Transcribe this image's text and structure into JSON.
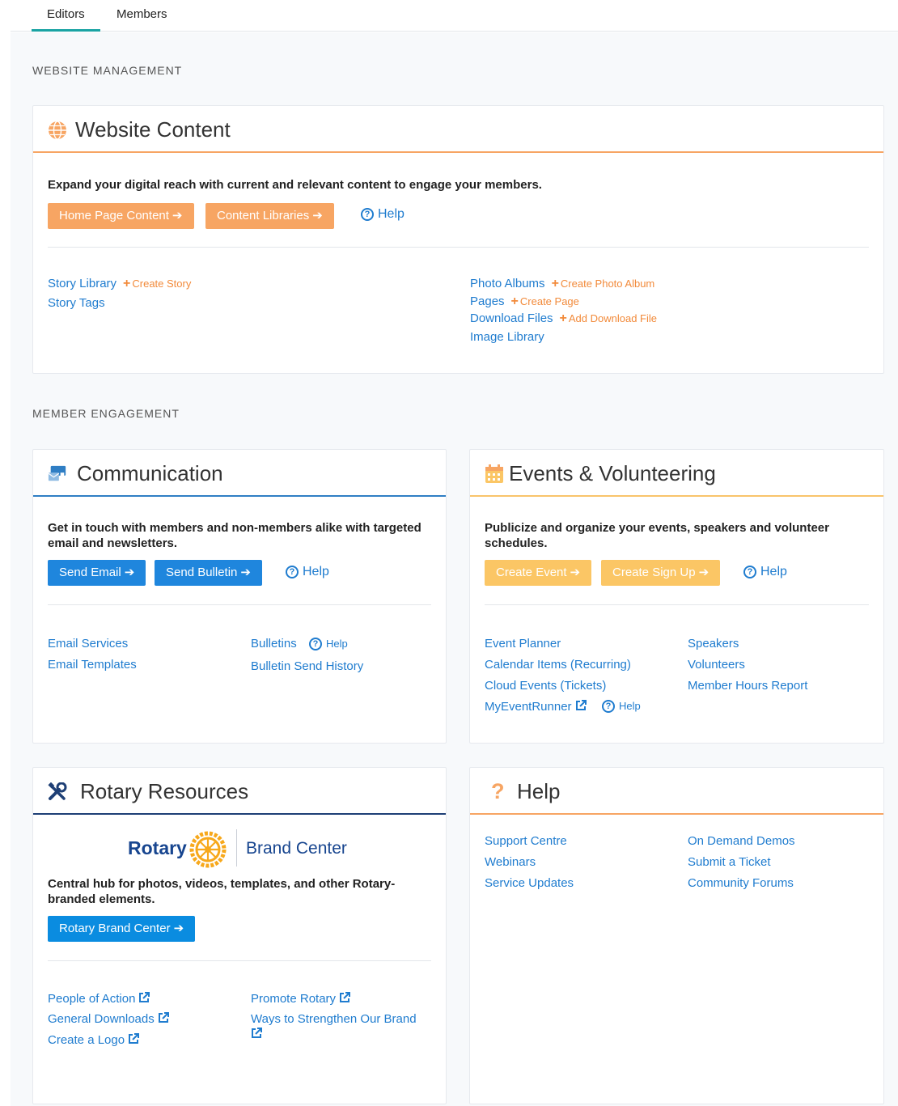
{
  "tabs": [
    "Editors",
    "Members"
  ],
  "sections": {
    "website_management": "WEBSITE MANAGEMENT",
    "member_engagement": "MEMBER ENGAGEMENT"
  },
  "website_content": {
    "title": "Website Content",
    "description": "Expand your digital reach with current and relevant content to engage your members.",
    "buttons": [
      "Home Page Content",
      "Content Libraries"
    ],
    "help": "Help",
    "left_links": [
      {
        "label": "Story Library",
        "add": "Create Story"
      },
      {
        "label": "Story Tags"
      }
    ],
    "right_links": [
      {
        "label": "Photo Albums",
        "add": "Create Photo Album"
      },
      {
        "label": "Pages",
        "add": "Create Page"
      },
      {
        "label": "Download Files",
        "add": "Add Download File"
      },
      {
        "label": "Image Library"
      }
    ]
  },
  "communication": {
    "title": "Communication",
    "description": "Get in touch with members and non-members alike with targeted email and newsletters.",
    "buttons": [
      "Send Email",
      "Send Bulletin"
    ],
    "help": "Help",
    "left_links": [
      "Email Services",
      "Email Templates"
    ],
    "right_links": [
      "Bulletins",
      "Bulletin Send History"
    ],
    "bulletins_help": "Help"
  },
  "events": {
    "title": "Events & Volunteering",
    "description": "Publicize and organize your events, speakers and volunteer schedules.",
    "buttons": [
      "Create Event",
      "Create Sign Up"
    ],
    "help": "Help",
    "left_links": [
      "Event Planner",
      "Calendar Items (Recurring)",
      "Cloud Events (Tickets)",
      "MyEventRunner"
    ],
    "myeventrunner_help": "Help",
    "right_links": [
      "Speakers",
      "Volunteers",
      "Member Hours Report"
    ]
  },
  "rotary": {
    "title": "Rotary Resources",
    "logo_word": "Rotary",
    "logo_tagline": "Brand Center",
    "description": "Central hub for photos, videos, templates, and other Rotary-branded elements.",
    "button": "Rotary Brand Center",
    "left_links": [
      "People of Action",
      "General Downloads",
      "Create a Logo"
    ],
    "right_links": [
      "Promote Rotary",
      "Ways to Strengthen Our Brand"
    ]
  },
  "help_card": {
    "title": "Help",
    "left_links": [
      "Support Centre",
      "Webinars",
      "Service Updates"
    ],
    "right_links": [
      "On Demand Demos",
      "Submit a Ticket",
      "Community Forums"
    ]
  },
  "colors": {
    "orange": "#f7a563",
    "blue": "#1f86dd",
    "gold": "#fbc665",
    "navy": "#1e3f75",
    "link": "#1f7ccf",
    "teal_tab": "#1aa3a3"
  }
}
